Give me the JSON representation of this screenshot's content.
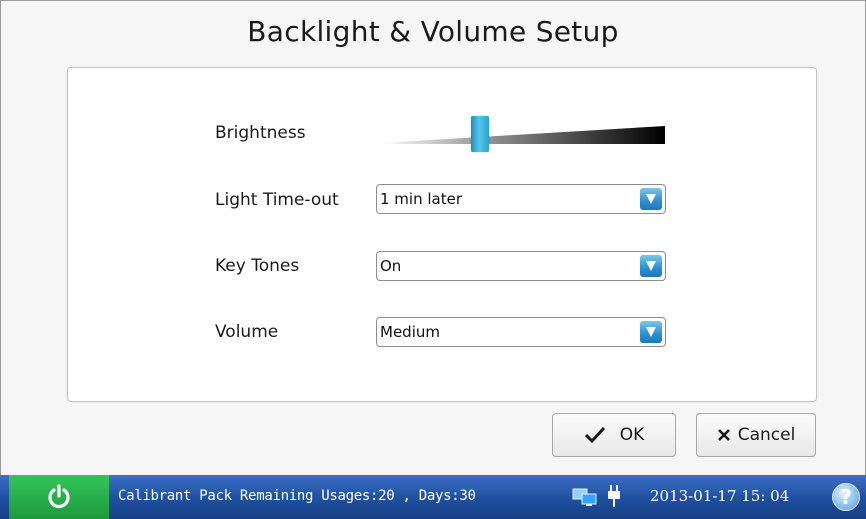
{
  "title": "Backlight & Volume Setup",
  "settings": {
    "brightness": {
      "label": "Brightness",
      "level": 0.35
    },
    "light_timeout": {
      "label": "Light Time-out",
      "value": "1 min later"
    },
    "key_tones": {
      "label": "Key Tones",
      "value": "On"
    },
    "volume": {
      "label": "Volume",
      "value": "Medium"
    }
  },
  "buttons": {
    "ok": "OK",
    "cancel": "Cancel"
  },
  "statusbar": {
    "message": "Calibrant Pack Remaining Usages:20 , Days:30",
    "datetime": "2013-01-17  15: 04",
    "help": "?"
  },
  "icons": {
    "power": "power-icon",
    "connection": "computer-connection-icon",
    "plug": "power-plug-icon",
    "help": "help-icon",
    "ok": "checkmark-icon",
    "cancel": "x-icon",
    "dropdown": "chevron-down-icon"
  },
  "colors": {
    "statusbar": "#1e4f9e",
    "power_button": "#1c9a3c",
    "slider_thumb": "#2aa1cd",
    "dropdown_arrow": "#2c8fd0"
  }
}
